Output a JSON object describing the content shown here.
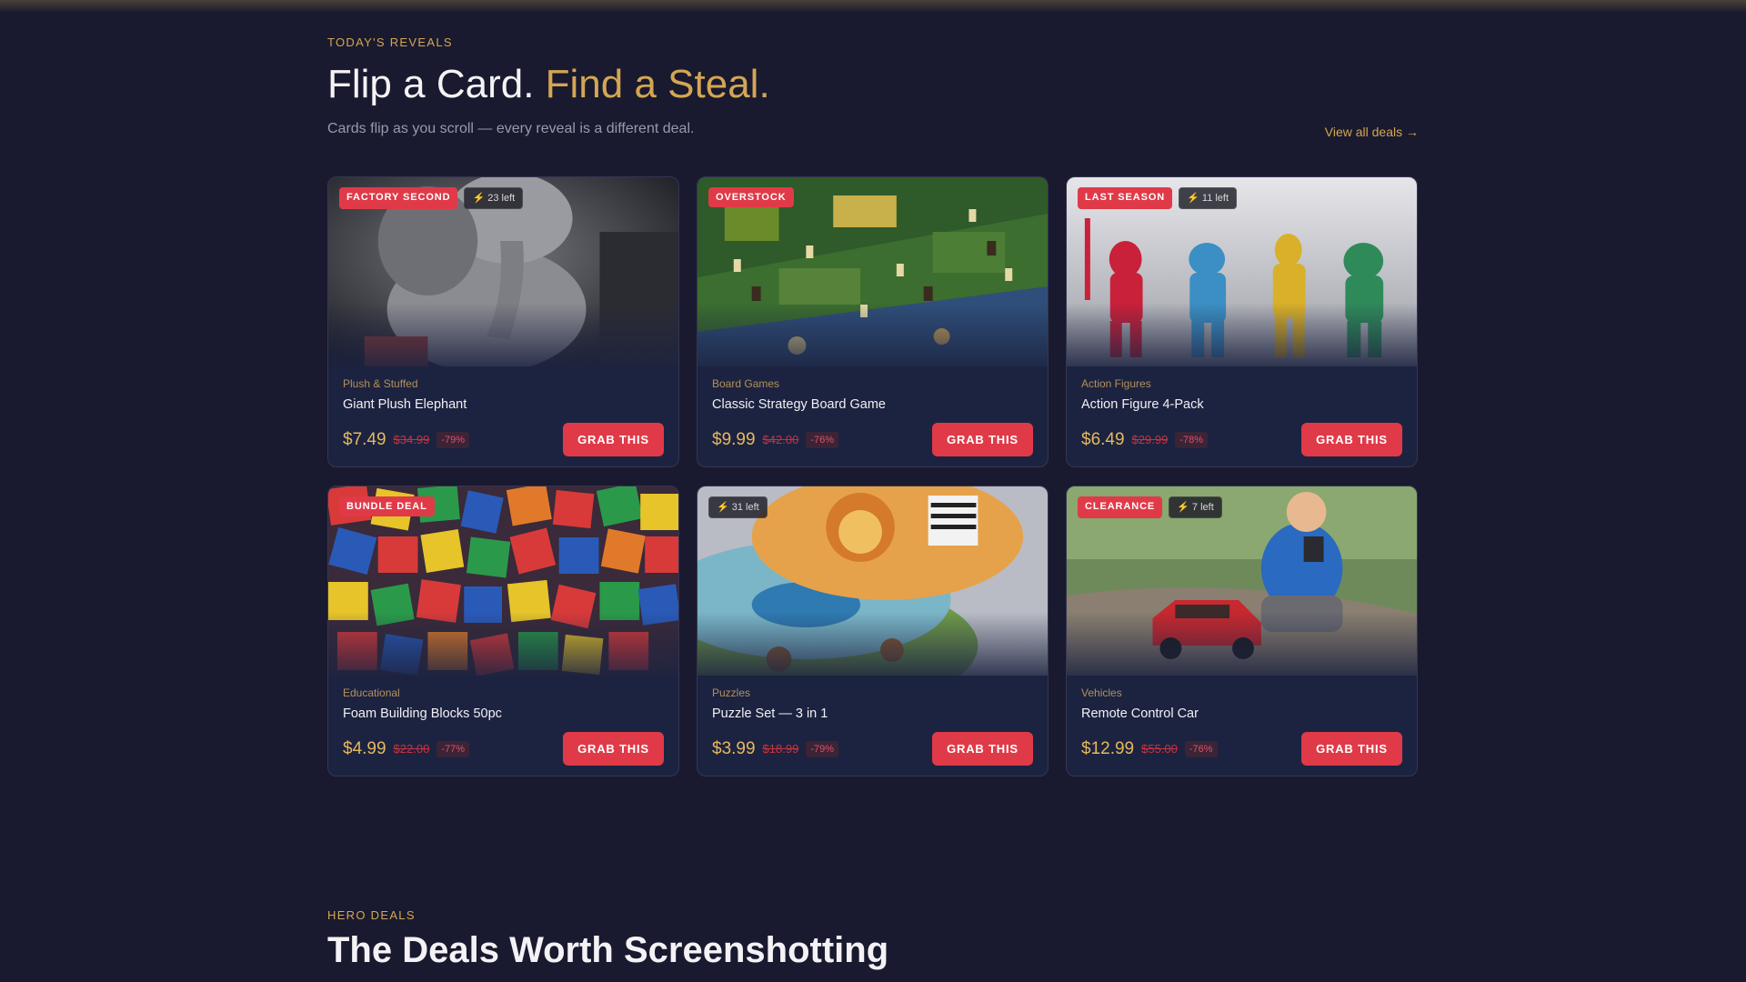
{
  "section": {
    "eyebrow": "TODAY'S REVEALS",
    "headline_main": "Flip a Card.",
    "headline_accent": "Find a Steal.",
    "subtitle": "Cards flip as you scroll — every reveal is a different deal.",
    "view_all": "View all deals →"
  },
  "cards": [
    {
      "tag": "FACTORY SECOND",
      "stock": "⚡ 23 left",
      "category": "Plush & Stuffed",
      "title": "Giant Plush Elephant",
      "price": "$7.49",
      "original": "$34.99",
      "discount": "-79%",
      "cta": "GRAB THIS",
      "image": "plush-elephant"
    },
    {
      "tag": "OVERSTOCK",
      "stock": "",
      "category": "Board Games",
      "title": "Classic Strategy Board Game",
      "price": "$9.99",
      "original": "$42.00",
      "discount": "-76%",
      "cta": "GRAB THIS",
      "image": "board-game"
    },
    {
      "tag": "LAST SEASON",
      "stock": "⚡ 11 left",
      "category": "Action Figures",
      "title": "Action Figure 4-Pack",
      "price": "$6.49",
      "original": "$29.99",
      "discount": "-78%",
      "cta": "GRAB THIS",
      "image": "action-figures"
    },
    {
      "tag": "BUNDLE DEAL",
      "stock": "",
      "category": "Educational",
      "title": "Foam Building Blocks 50pc",
      "price": "$4.99",
      "original": "$22.00",
      "discount": "-77%",
      "cta": "GRAB THIS",
      "image": "foam-blocks"
    },
    {
      "tag": "",
      "stock": "⚡ 31 left",
      "category": "Puzzles",
      "title": "Puzzle Set — 3 in 1",
      "price": "$3.99",
      "original": "$18.99",
      "discount": "-79%",
      "cta": "GRAB THIS",
      "image": "puzzles"
    },
    {
      "tag": "CLEARANCE",
      "stock": "⚡ 7 left",
      "category": "Vehicles",
      "title": "Remote Control Car",
      "price": "$12.99",
      "original": "$55.00",
      "discount": "-76%",
      "cta": "GRAB THIS",
      "image": "rc-car"
    }
  ],
  "hero": {
    "eyebrow": "HERO DEALS",
    "headline": "The Deals Worth Screenshotting"
  },
  "colors": {
    "background": "#191a2f",
    "accent_gold": "#d4a653",
    "accent_red": "#e03a48"
  }
}
